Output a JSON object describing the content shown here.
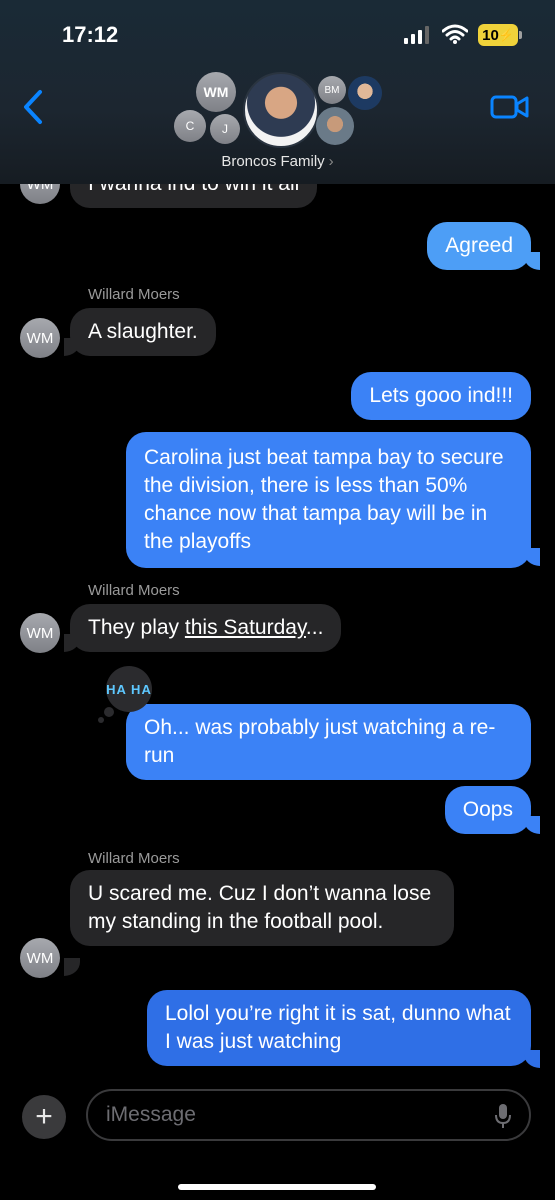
{
  "status_bar": {
    "time": "17:12",
    "battery": "10"
  },
  "header": {
    "group_name": "Broncos Family",
    "avatars": [
      {
        "initials": "WM"
      },
      {
        "initials": "C"
      },
      {
        "initials": "J"
      },
      {
        "initials": "BM"
      }
    ]
  },
  "messages": [
    {
      "id": "m0",
      "from": "Willard Moers",
      "direction": "incoming",
      "avatar": "WM",
      "text": "I wanna ind to win it all"
    },
    {
      "id": "m1",
      "direction": "outgoing",
      "text": "Agreed"
    },
    {
      "id": "m2",
      "from": "Willard Moers",
      "direction": "incoming",
      "avatar": "WM",
      "text": "A slaughter."
    },
    {
      "id": "m3",
      "direction": "outgoing",
      "text": "Lets gooo ind!!!"
    },
    {
      "id": "m4",
      "direction": "outgoing",
      "text": "Carolina just beat tampa bay to secure the division, there is less than 50% chance now that tampa bay will be in the playoffs"
    },
    {
      "id": "m5",
      "from": "Willard Moers",
      "direction": "incoming",
      "avatar": "WM",
      "text_prefix": "They play ",
      "text_link": "this Saturday",
      "text_suffix": "..."
    },
    {
      "id": "m6",
      "direction": "outgoing",
      "reaction": "HA HA",
      "text": "Oh... was probably just watching a re-run"
    },
    {
      "id": "m7",
      "direction": "outgoing",
      "text": "Oops"
    },
    {
      "id": "m8",
      "from": "Willard Moers",
      "direction": "incoming",
      "avatar": "WM",
      "text": "U scared me. Cuz I don’t wanna lose my standing in the football pool."
    },
    {
      "id": "m9",
      "direction": "outgoing",
      "text": "Lolol you’re right it is sat, dunno what I was just watching"
    }
  ],
  "sender_labels": [
    "Willard Moers",
    "Willard Moers",
    "Willard Moers"
  ],
  "composer": {
    "placeholder": "iMessage"
  },
  "icons": [
    "back-chevron-icon",
    "video-call-icon",
    "plus-icon",
    "microphone-icon",
    "signal-icon",
    "wifi-icon"
  ],
  "colors": {
    "outgoing": "#3b82f6",
    "incoming": "#262628",
    "link": "#007aff"
  }
}
